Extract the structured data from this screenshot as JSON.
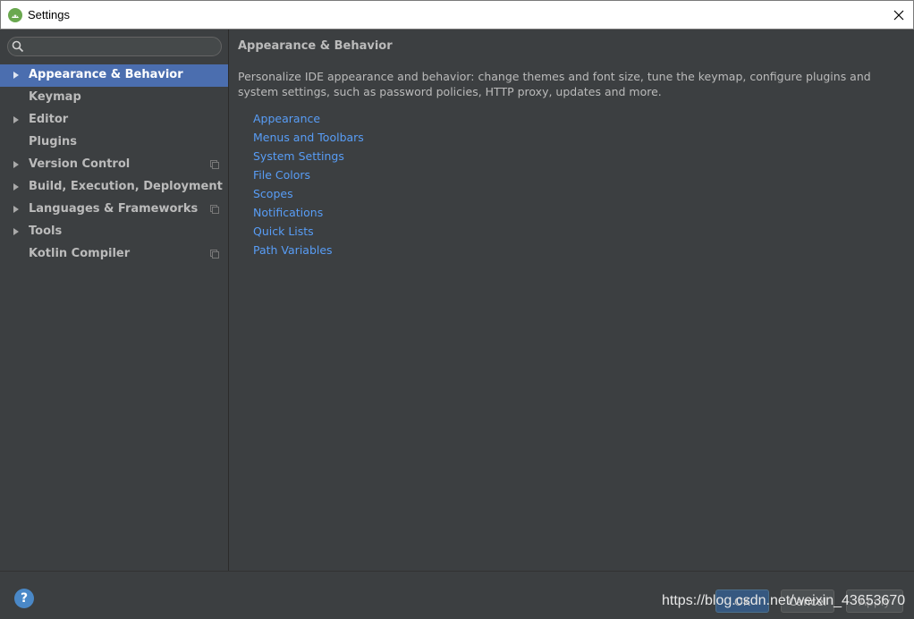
{
  "window": {
    "title": "Settings",
    "icon": "android-studio-icon",
    "close_icon": "close-icon"
  },
  "search": {
    "placeholder": "",
    "value": ""
  },
  "sidebar": {
    "items": [
      {
        "label": "Appearance & Behavior",
        "expandable": true,
        "selected": true,
        "badge": false
      },
      {
        "label": "Keymap",
        "expandable": false,
        "selected": false,
        "badge": false
      },
      {
        "label": "Editor",
        "expandable": true,
        "selected": false,
        "badge": false
      },
      {
        "label": "Plugins",
        "expandable": false,
        "selected": false,
        "badge": false
      },
      {
        "label": "Version Control",
        "expandable": true,
        "selected": false,
        "badge": true
      },
      {
        "label": "Build, Execution, Deployment",
        "expandable": true,
        "selected": false,
        "badge": false
      },
      {
        "label": "Languages & Frameworks",
        "expandable": true,
        "selected": false,
        "badge": true
      },
      {
        "label": "Tools",
        "expandable": true,
        "selected": false,
        "badge": false
      },
      {
        "label": "Kotlin Compiler",
        "expandable": false,
        "selected": false,
        "badge": true
      }
    ]
  },
  "main": {
    "title": "Appearance & Behavior",
    "description": "Personalize IDE appearance and behavior: change themes and font size, tune the keymap, configure plugins and system settings, such as password policies, HTTP proxy, updates and more.",
    "links": [
      "Appearance",
      "Menus and Toolbars",
      "System Settings",
      "File Colors",
      "Scopes",
      "Notifications",
      "Quick Lists",
      "Path Variables"
    ]
  },
  "footer": {
    "help_label": "?",
    "ok_label": "OK",
    "cancel_label": "Cancel",
    "apply_label": "Apply",
    "watermark": "https://blog.csdn.net/weixin_43653670"
  },
  "colors": {
    "background": "#3c3f41",
    "selection": "#4b6eaf",
    "link": "#589df6",
    "text": "#bbbbbb"
  }
}
